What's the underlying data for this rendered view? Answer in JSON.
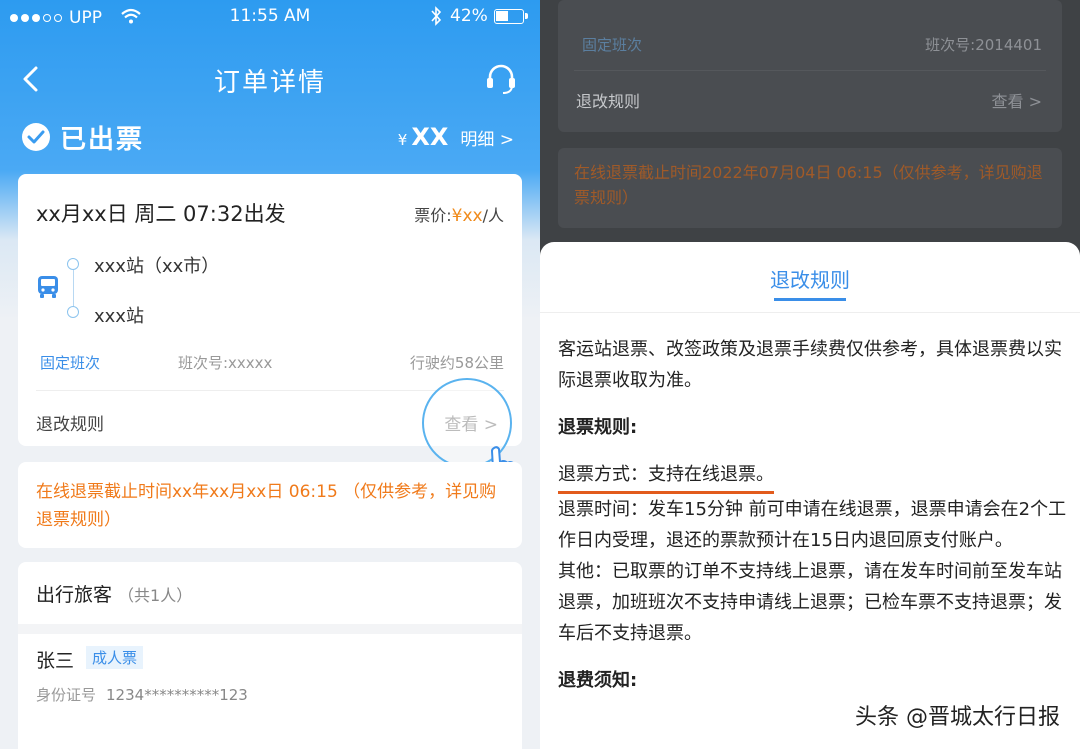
{
  "statusbar": {
    "carrier": "UPP",
    "time": "11:55 AM",
    "battery": "42%"
  },
  "nav": {
    "title": "订单详情"
  },
  "order_status": {
    "label": "已出票",
    "currency": "¥",
    "amount": "XX",
    "detail_link": "明细 >"
  },
  "trip": {
    "datetime": "xx月xx日  周二  07:32出发",
    "fare_label": "票价:",
    "fare_amount": "¥xx",
    "fare_unit": "/人",
    "from_station": "xxx站（xx市）",
    "to_station": "xxx站",
    "service_type": "固定班次",
    "service_no": "班次号:xxxxx",
    "distance": "行驶约58公里",
    "refund_rules_label": "退改规则",
    "view_label": "查看 >"
  },
  "notice": {
    "text": "在线退票截止时间xx年xx月xx日 06:15 （仅供参考，详见购退票规则）"
  },
  "passengers": {
    "title": "出行旅客",
    "count": "（共1人）",
    "name": "张三",
    "ticket_type": "成人票",
    "id_label": "身份证号",
    "id_value": "1234**********123"
  },
  "background": {
    "service_type": "固定班次",
    "service_no": "班次号:2014401",
    "refund_rules_label": "退改规则",
    "view_label": "查看 >",
    "notice": "在线退票截止时间2022年07月04日 06:15（仅供参考，详见购退票规则）"
  },
  "sheet": {
    "title": "退改规则",
    "intro": "客运站退票、改签政策及退票手续费仅供参考，具体退票费以实际退票收取为准。",
    "refund_rules_heading": "退票规则:",
    "method": "退票方式：支持在线退票。",
    "time": "退票时间：发车15分钟 前可申请在线退票，退票申请会在2个工作日内受理，退还的票款预计在15日内退回原支付账户。",
    "other": "其他：已取票的订单不支持线上退票，请在发车时间前至发车站退票，加班班次不支持申请线上退票；已检车票不支持退票；发车后不支持退票。",
    "fee_heading": "退费须知:"
  },
  "watermark": "头条 @晋城太行日报",
  "colors": {
    "primary_blue": "#2d9bf0",
    "link_blue": "#3a8ee8",
    "warning_orange": "#f07a1a",
    "highlight_underline": "#e25b1c"
  }
}
